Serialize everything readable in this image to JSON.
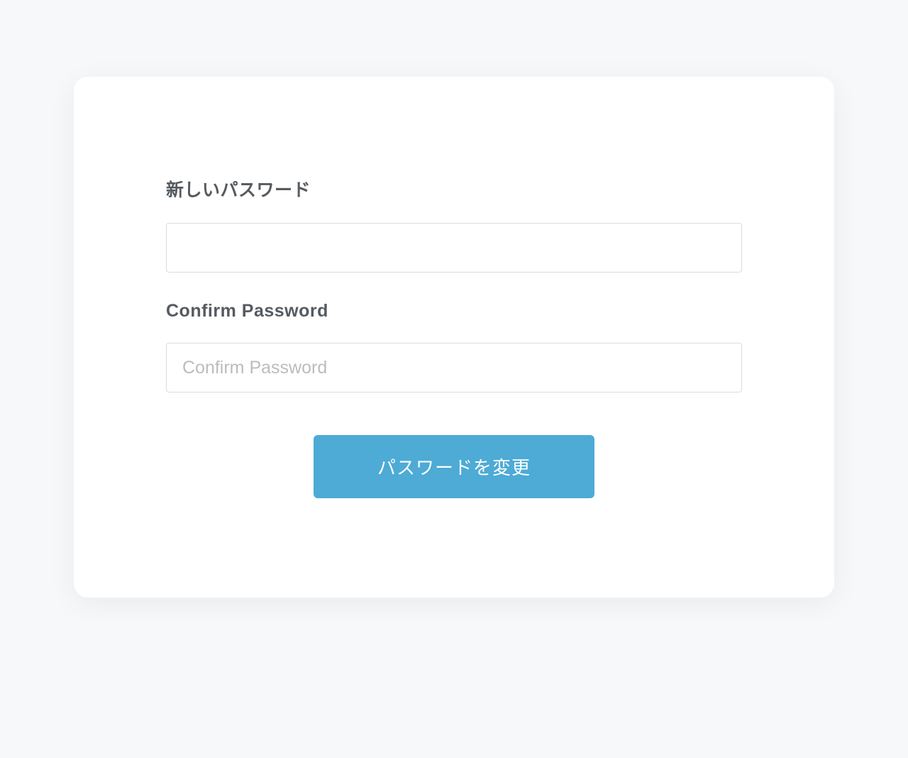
{
  "form": {
    "new_password": {
      "label": "新しいパスワード",
      "value": "",
      "placeholder": ""
    },
    "confirm_password": {
      "label": "Confirm Password",
      "value": "",
      "placeholder": "Confirm Password"
    },
    "submit_label": "パスワードを変更"
  }
}
